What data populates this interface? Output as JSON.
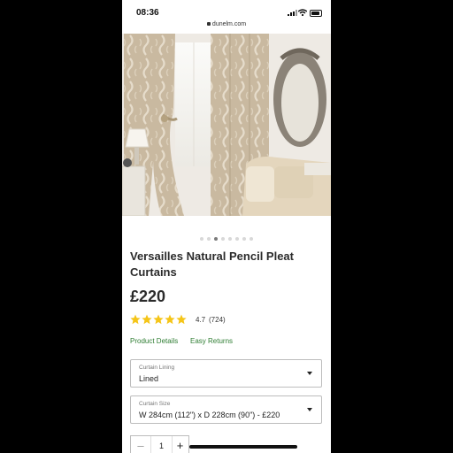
{
  "status": {
    "time": "08:36",
    "url": "dunelm.com"
  },
  "gallery": {
    "dot_count": 8,
    "active_index": 2
  },
  "product": {
    "title": "Versailles Natural Pencil Pleat Curtains",
    "price": "£220",
    "rating": "4.7",
    "review_count": "(724)",
    "star_color": "#f5c518",
    "links": {
      "details": "Product Details",
      "returns": "Easy Returns"
    },
    "link_color": "#2e7d32"
  },
  "options": {
    "lining": {
      "label": "Curtain Lining",
      "value": "Lined"
    },
    "size": {
      "label": "Curtain Size",
      "value": "W 284cm (112\") x D 228cm (90\") - £220"
    }
  },
  "quantity": {
    "minus": "–",
    "value": "1",
    "plus": "+"
  }
}
